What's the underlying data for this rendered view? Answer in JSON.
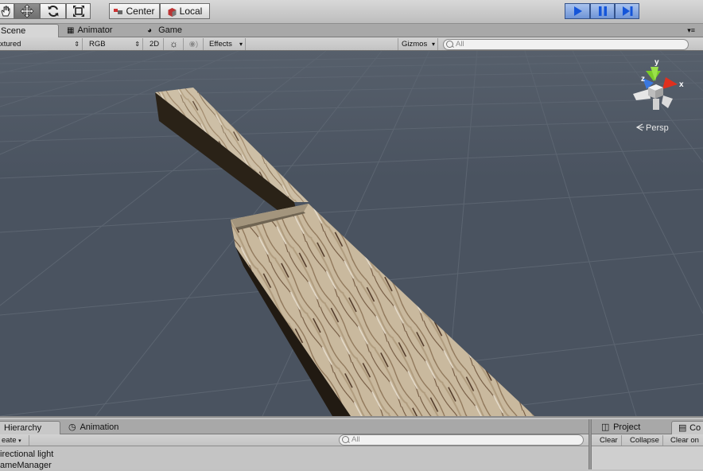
{
  "toolbar": {
    "tools": [
      "hand-tool",
      "move-tool",
      "rotate-tool",
      "scale-tool"
    ],
    "pivot_label": "Center",
    "space_label": "Local",
    "play_controls": [
      "play",
      "pause",
      "step"
    ]
  },
  "scene_tabs": [
    {
      "label": "Scene",
      "icon": "scene-icon"
    },
    {
      "label": "Animator",
      "icon": "animator-icon"
    },
    {
      "label": "Game",
      "icon": "game-icon"
    }
  ],
  "scene_options": {
    "draw_mode": "xtured",
    "render_mode": "RGB",
    "toggle_2d": "2D",
    "effects_label": "Effects",
    "gizmos_label": "Gizmos",
    "search_placeholder": "All"
  },
  "scene_gizmo": {
    "axis_y": "y",
    "axis_x": "x",
    "axis_z": "z",
    "projection": "Persp"
  },
  "colors": {
    "scene_bg": "#4b5461",
    "grid": "#5d6673",
    "axis_x": "#e0301e",
    "axis_y": "#7ccc29",
    "axis_z": "#3a78e0",
    "wood": "#c7b8a0"
  },
  "hierarchy": {
    "tabs": [
      {
        "label": "Hierarchy",
        "icon": "hierarchy-icon"
      },
      {
        "label": "Animation",
        "icon": "clock-icon"
      }
    ],
    "create_label": "eate",
    "search_placeholder": "All",
    "items": [
      "irectional light",
      "ameManager"
    ]
  },
  "project_panel": {
    "tabs": [
      {
        "label": "Project",
        "icon": "folder-icon"
      },
      {
        "label": "Co",
        "icon": "console-icon"
      }
    ],
    "console_buttons": [
      "Clear",
      "Collapse",
      "Clear on"
    ]
  }
}
